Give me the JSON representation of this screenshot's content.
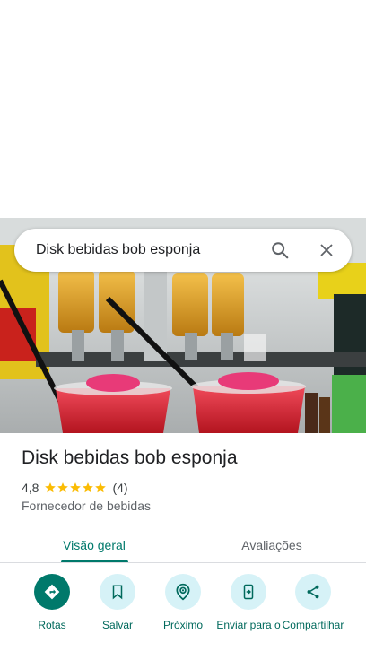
{
  "search": {
    "query": "Disk bebidas bob esponja",
    "search_icon": "search-icon",
    "close_icon": "close-icon"
  },
  "place": {
    "name": "Disk bebidas bob esponja",
    "rating": "4,8",
    "rating_stars": 5,
    "reviews": "(4)",
    "category": "Fornecedor de bebidas"
  },
  "tabs": [
    {
      "label": "Visão geral",
      "active": true
    },
    {
      "label": "Avaliações",
      "active": false
    }
  ],
  "actions": [
    {
      "label": "Rotas",
      "icon": "directions-icon"
    },
    {
      "label": "Salvar",
      "icon": "bookmark-icon"
    },
    {
      "label": "Próximo",
      "icon": "nearby-icon"
    },
    {
      "label": "Enviar para o",
      "icon": "send-to-phone-icon"
    },
    {
      "label": "Compartilhar",
      "icon": "share-icon"
    }
  ],
  "colors": {
    "accent": "#00796b",
    "action_bg": "#d6f2f7",
    "star": "#fbbc04"
  }
}
